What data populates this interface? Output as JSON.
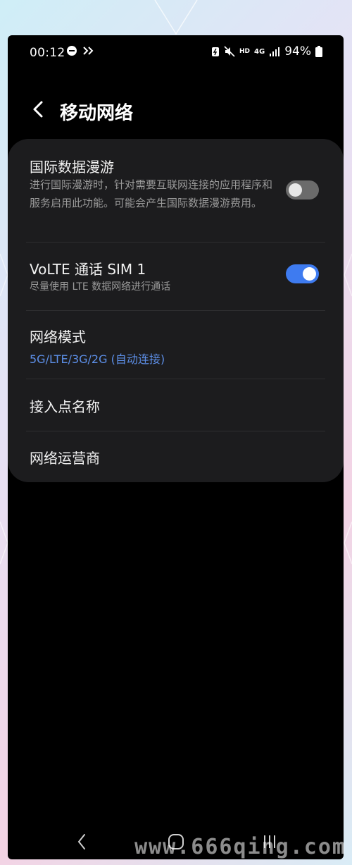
{
  "status_bar": {
    "time": "00:12",
    "battery_text": "94%",
    "icons": [
      "dnd-icon",
      "signal-call-icon",
      "battery-saver-icon",
      "mute-icon",
      "hd-voice-icon",
      "4g-lte-icon",
      "signal-bars-icon",
      "battery-icon"
    ],
    "hd_label": "HD",
    "network_label": "4G"
  },
  "header": {
    "title": "移动网络",
    "back_icon": "chevron-left-icon"
  },
  "settings": {
    "roaming": {
      "title": "国际数据漫游",
      "description": "进行国际漫游时，针对需要互联网连接的应用程序和服务启用此功能。可能会产生国际数据漫游费用。",
      "enabled": false
    },
    "volte": {
      "title": "VoLTE 通话 SIM 1",
      "description": "尽量使用 LTE 数据网络进行通话",
      "enabled": true
    },
    "network_mode": {
      "title": "网络模式",
      "value": "5G/LTE/3G/2G (自动连接)"
    },
    "apn": {
      "title": "接入点名称"
    },
    "operators": {
      "title": "网络运营商"
    }
  },
  "colors": {
    "accent": "#3e7bf0",
    "value_text": "#5d8fe8",
    "card_bg": "#1c1c1e",
    "screen_bg": "#000000"
  },
  "navbar": {
    "icons": [
      "back-nav-icon",
      "home-nav-icon",
      "recents-nav-icon"
    ]
  },
  "watermark": "www.666qing.com"
}
